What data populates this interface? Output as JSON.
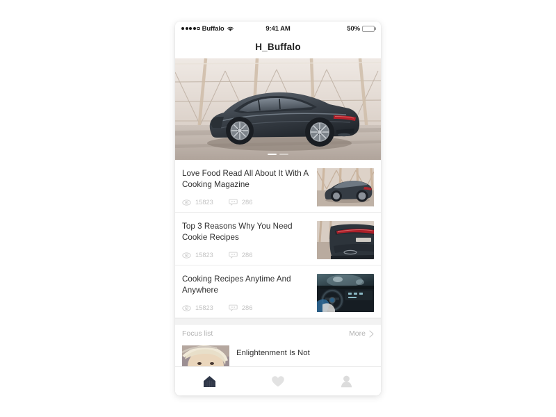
{
  "colors": {
    "page_background": "#ffffff",
    "card_background": "#ffffff",
    "title_text": "#222222",
    "body_text": "#2e2e2e",
    "muted_text": "#c3c3c3",
    "divider": "#ececec",
    "section_gap": "#f2f2f2",
    "battery_fill": "#f8cf3e",
    "tab_active": "#2e3647",
    "tab_inactive": "#e2e2e2"
  },
  "status_bar": {
    "signal_dots_filled": 4,
    "signal_dots_total": 5,
    "carrier": "Buffalo",
    "wifi_icon": "wifi-icon",
    "time": "9:41 AM",
    "battery_percent_label": "50%",
    "battery_level": 50
  },
  "header": {
    "title": "H_Buffalo"
  },
  "hero": {
    "image_alt": "dark grey luxury coupe parked inside a modern hall with triangular timber truss ceiling",
    "pager": {
      "total": 2,
      "active_index": 0
    }
  },
  "articles": [
    {
      "title": "Love Food Read All About It With A Cooking Magazine",
      "views_icon": "eye-icon",
      "views": "15823",
      "comments_icon": "comment-icon",
      "comments": "286",
      "thumbnail_alt": "grey coupe rear three-quarter view inside bright hall"
    },
    {
      "title": "Top 3 Reasons Why You Need Cookie Recipes",
      "views_icon": "eye-icon",
      "views": "15823",
      "comments_icon": "comment-icon",
      "comments": "286",
      "thumbnail_alt": "close-up of car rear with red taillight bar"
    },
    {
      "title": "Cooking Recipes Anytime And Anywhere",
      "views_icon": "eye-icon",
      "views": "15823",
      "comments_icon": "comment-icon",
      "comments": "286",
      "thumbnail_alt": "dark car interior with steering wheel and dashboard at night"
    }
  ],
  "focus_list": {
    "label": "Focus list",
    "more_label": "More",
    "more_icon": "chevron-right-icon",
    "items": [
      {
        "title": "Enlightenment Is Not",
        "thumbnail_alt": "portrait of a blonde woman with red lips"
      }
    ]
  },
  "tab_bar": {
    "items": [
      {
        "name": "home",
        "icon": "home-icon",
        "active": true
      },
      {
        "name": "favorites",
        "icon": "heart-icon",
        "active": false
      },
      {
        "name": "profile",
        "icon": "person-icon",
        "active": false
      }
    ]
  }
}
